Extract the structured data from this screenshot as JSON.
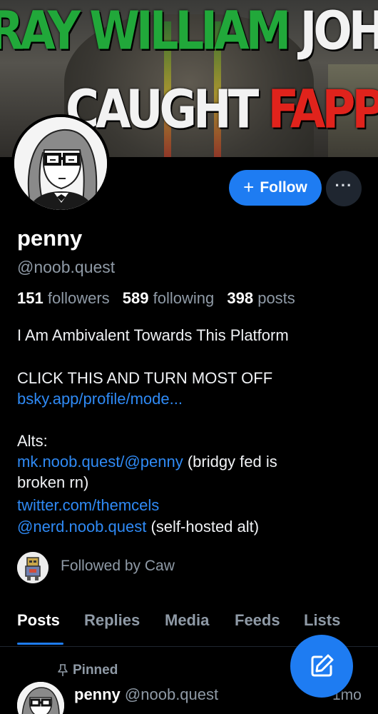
{
  "banner": {
    "line1": [
      {
        "text": "RAY WILLIAM ",
        "color": "#21a83a"
      },
      {
        "text": "JOHNSON WAS",
        "color": "#f2f2f2"
      }
    ],
    "line2": [
      {
        "text": "CAUGHT ",
        "color": "#f2f2f2"
      },
      {
        "text": "FAPPING",
        "color": "#e0231c"
      }
    ]
  },
  "profile": {
    "display_name": "penny",
    "handle": "@noob.quest",
    "follow_label": "Follow",
    "follow_icon": "plus-icon",
    "more_icon": "ellipsis-icon",
    "more_label": "···"
  },
  "stats": {
    "followers_count": "151",
    "followers_label": "followers",
    "following_count": "589",
    "following_label": "following",
    "posts_count": "398",
    "posts_label": "posts"
  },
  "bio": {
    "line1": "I Am Ambivalent Towards This Platform",
    "line2": "CLICK THIS AND TURN MOST OFF",
    "link1": "bsky.app/profile/mode...",
    "alts_label": "Alts:",
    "alt1_link": "mk.noob.quest/@penny",
    "alt1_note": " (bridgy fed is",
    "alt1_note_cont": "broken rn)",
    "alt2_link": "twitter.com/themcels",
    "alt3_link": "@nerd.noob.quest",
    "alt3_note": " (self-hosted alt)"
  },
  "followed_by": {
    "text": "Followed by Caw"
  },
  "tabs": [
    {
      "label": "Posts",
      "active": true
    },
    {
      "label": "Replies",
      "active": false
    },
    {
      "label": "Media",
      "active": false
    },
    {
      "label": "Feeds",
      "active": false
    },
    {
      "label": "Lists",
      "active": false
    }
  ],
  "pinned_post": {
    "pinned_label": "Pinned",
    "author_name": "penny",
    "author_handle": "@noob.quest",
    "time": "1mo"
  },
  "colors": {
    "accent": "#1e7cf2",
    "link": "#2f8af5",
    "muted": "#8f9aa6",
    "background": "#000000"
  },
  "fab": {
    "icon": "compose-icon"
  }
}
